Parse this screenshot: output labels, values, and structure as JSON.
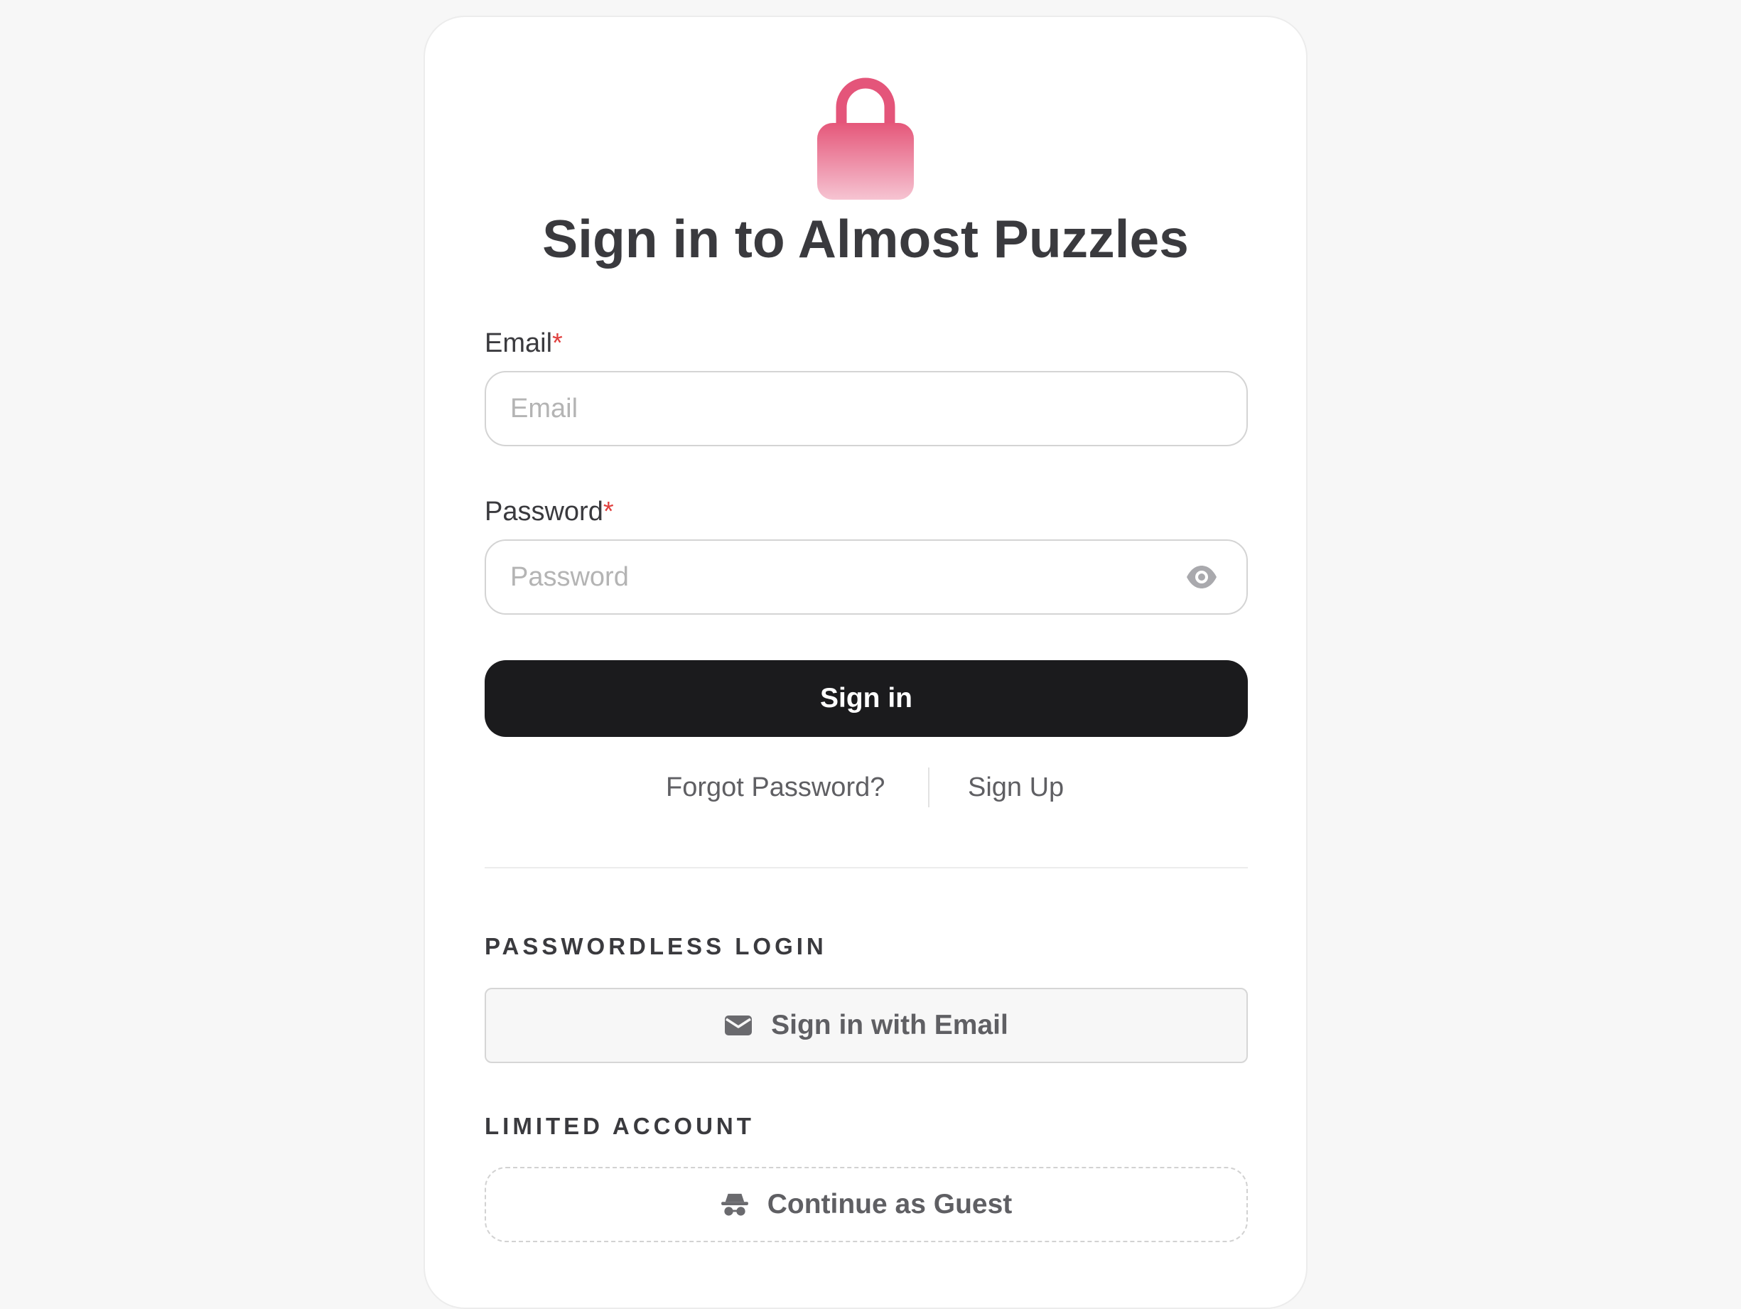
{
  "page": {
    "title": "Sign in to Almost Puzzles",
    "lock_icon": "lock-icon",
    "brand_gradient": [
      "#e5577a",
      "#f6c4d2"
    ]
  },
  "form": {
    "email_label": "Email",
    "email_required_mark": "*",
    "email_placeholder": "Email",
    "email_value": "",
    "password_label": "Password",
    "password_required_mark": "*",
    "password_placeholder": "Password",
    "password_value": "",
    "password_toggle_icon": "eye-icon",
    "submit_label": "Sign in"
  },
  "links": {
    "forgot_password": "Forgot Password?",
    "sign_up": "Sign Up"
  },
  "passwordless": {
    "section_title": "PASSWORDLESS LOGIN",
    "button_label": "Sign in with Email",
    "button_icon": "envelope-icon"
  },
  "limited": {
    "section_title": "LIMITED ACCOUNT",
    "button_label": "Continue as Guest",
    "button_icon": "incognito-icon"
  },
  "colors": {
    "primary_button": "#1b1b1d",
    "required": "#e0403f",
    "background": "#f7f7f7"
  }
}
